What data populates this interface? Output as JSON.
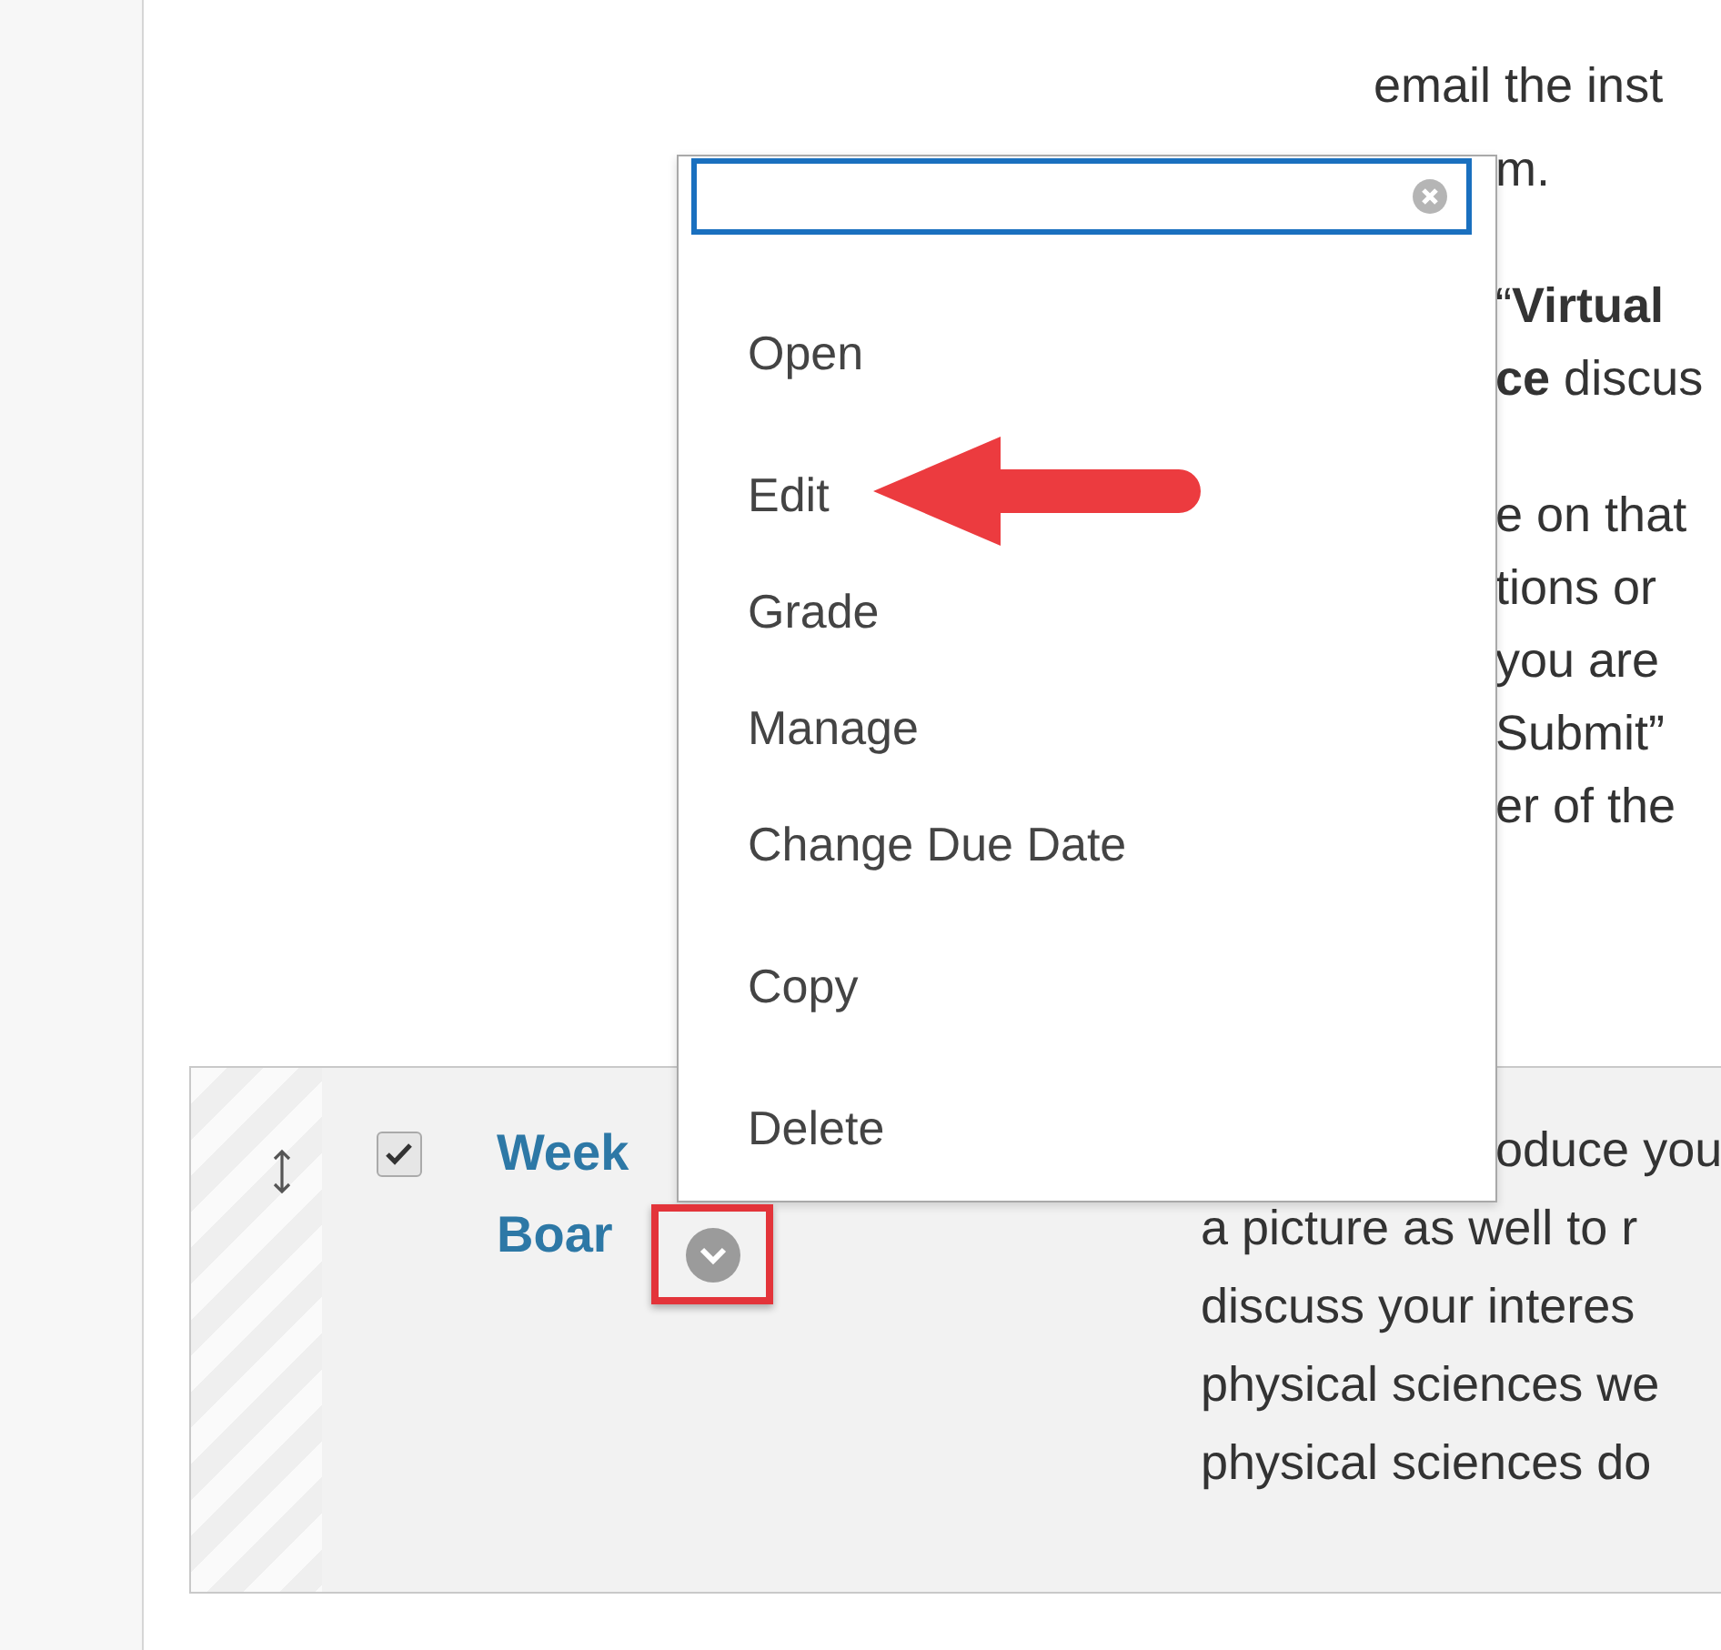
{
  "content_text": {
    "above_menu": [
      "email the inst"
    ],
    "beside_menu": [
      [
        "m."
      ],
      [
        "“**Virtual**",
        "**ce** discus"
      ],
      [
        "e on that",
        "tions or",
        "you are",
        "Submit”",
        "er of the"
      ]
    ]
  },
  "item_row": {
    "checked": true,
    "title_lines": [
      "Week",
      "Boar"
    ],
    "description_lines": [
      "oduce you",
      "a picture as well to r",
      "discuss your interes",
      "physical sciences we",
      "physical sciences do"
    ]
  },
  "context_menu": {
    "groups": [
      [
        "Open"
      ],
      [
        "Edit",
        "Grade",
        "Manage",
        "Change Due Date"
      ],
      [
        "Copy"
      ],
      [
        "Delete"
      ]
    ]
  }
}
